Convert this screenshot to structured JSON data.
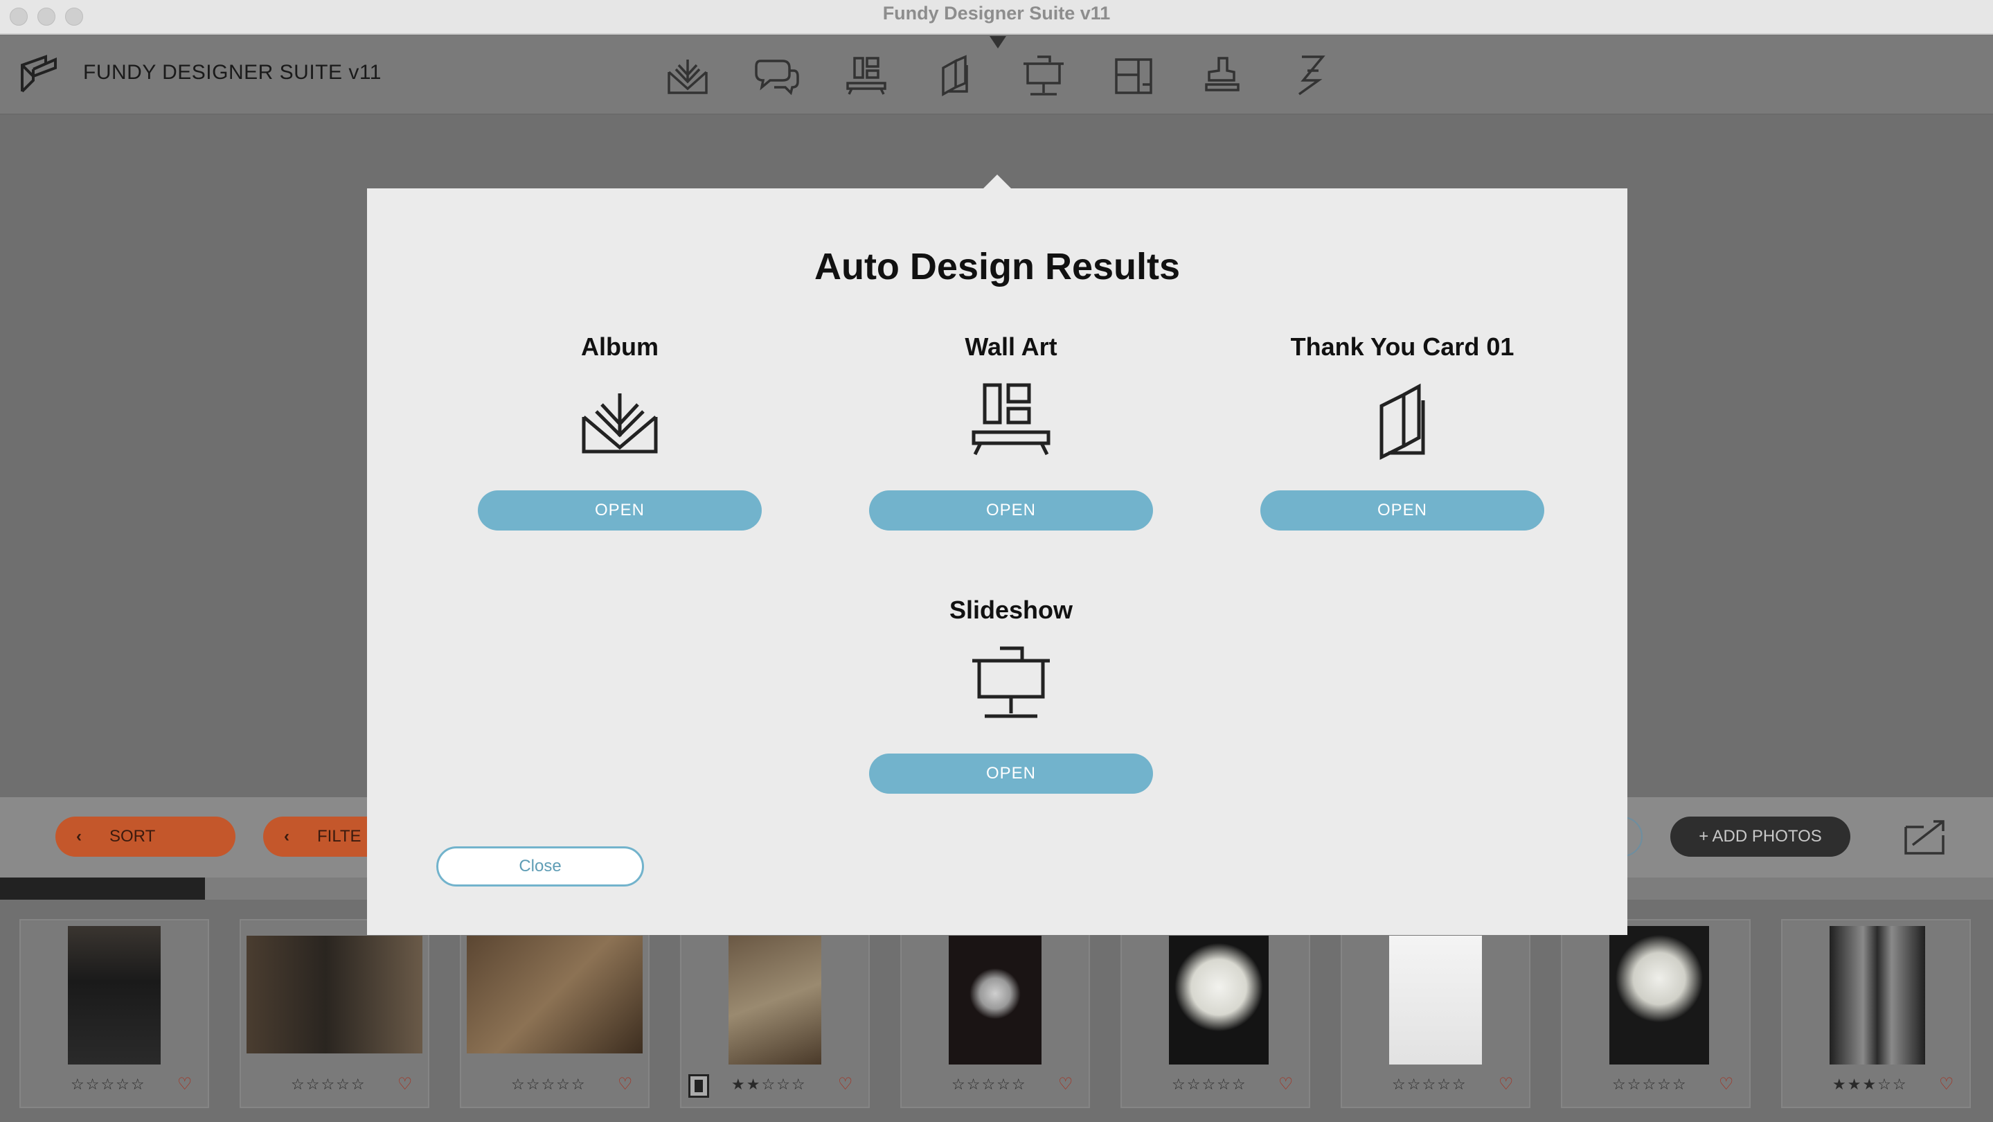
{
  "window": {
    "title": "Fundy Designer Suite v11"
  },
  "app": {
    "name": "FUNDY DESIGNER SUITE v11"
  },
  "toolbar": {
    "icons": [
      "album-icon",
      "proof-chat-icon",
      "wall-art-icon",
      "cards-icon",
      "slideshow-icon",
      "layout-icon",
      "stamp-icon",
      "fundy-f-icon"
    ]
  },
  "modal": {
    "title": "Auto Design Results",
    "results": [
      {
        "label": "Album",
        "button": "OPEN",
        "icon": "album-icon"
      },
      {
        "label": "Wall Art",
        "button": "OPEN",
        "icon": "wall-art-icon"
      },
      {
        "label": "Thank You Card 01",
        "button": "OPEN",
        "icon": "cards-icon"
      },
      {
        "label": "Slideshow",
        "button": "OPEN",
        "icon": "slideshow-icon"
      }
    ],
    "close_label": "Close"
  },
  "bottombar": {
    "sort_label": "SORT",
    "filter_label": "FILTE",
    "add_photos_label": "+ ADD PHOTOS"
  },
  "progress": {
    "fraction": 0.103
  },
  "photos": [
    {
      "stars": "☆☆☆☆☆",
      "rating": 0
    },
    {
      "stars": "☆☆☆☆☆",
      "rating": 0
    },
    {
      "stars": "☆☆☆☆☆",
      "rating": 0
    },
    {
      "stars": "★★☆☆☆",
      "rating": 2
    },
    {
      "stars": "☆☆☆☆☆",
      "rating": 0
    },
    {
      "stars": "☆☆☆☆☆",
      "rating": 0
    },
    {
      "stars": "☆☆☆☆☆",
      "rating": 0
    },
    {
      "stars": "☆☆☆☆☆",
      "rating": 0
    },
    {
      "stars": "★★★☆☆",
      "rating": 3
    }
  ],
  "colors": {
    "accent": "#72b3cc",
    "orange": "#c4572b",
    "heart": "#a82a17"
  }
}
